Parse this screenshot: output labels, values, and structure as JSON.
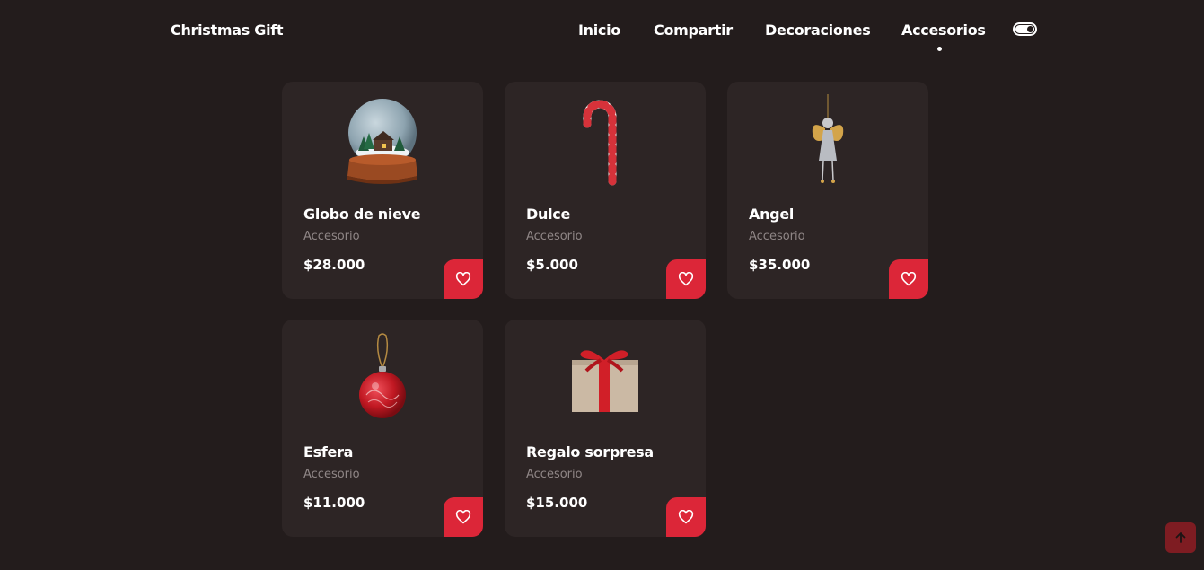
{
  "header": {
    "brand": "Christmas Gift",
    "nav": [
      "Inicio",
      "Compartir",
      "Decoraciones",
      "Accesorios"
    ],
    "active_nav": "Accesorios"
  },
  "products": [
    {
      "title": "Globo de nieve",
      "category": "Accesorio",
      "price": "$28.000",
      "icon": "snow-globe-icon"
    },
    {
      "title": "Dulce",
      "category": "Accesorio",
      "price": "$5.000",
      "icon": "candy-cane-icon"
    },
    {
      "title": "Angel",
      "category": "Accesorio",
      "price": "$35.000",
      "icon": "angel-ornament-icon"
    },
    {
      "title": "Esfera",
      "category": "Accesorio",
      "price": "$11.000",
      "icon": "bauble-icon"
    },
    {
      "title": "Regalo sorpresa",
      "category": "Accesorio",
      "price": "$15.000",
      "icon": "gift-box-icon"
    }
  ],
  "colors": {
    "background": "#231c1c",
    "card": "#2d2525",
    "accent": "#dc2638",
    "muted_text": "#8f8686",
    "scroll_top": "#7e1c22"
  }
}
